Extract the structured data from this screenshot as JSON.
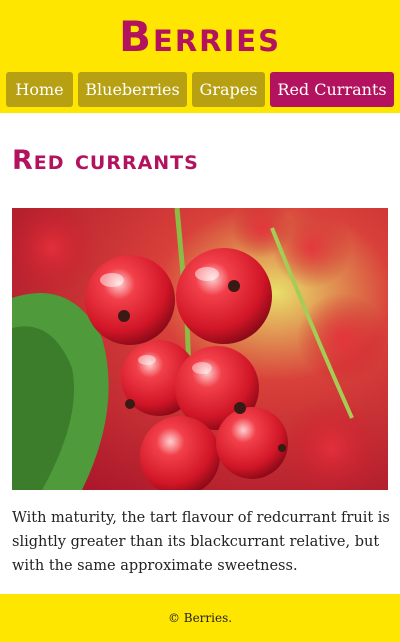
{
  "header": {
    "title": "Berries"
  },
  "nav": {
    "items": [
      {
        "label": "Home",
        "active": false
      },
      {
        "label": "Blueberries",
        "active": false
      },
      {
        "label": "Grapes",
        "active": false
      },
      {
        "label": "Red Currants",
        "active": true
      }
    ]
  },
  "main": {
    "heading": "Red currants",
    "image": {
      "subject": "red-currants-photo"
    },
    "paragraph": "With maturity, the tart flavour of redcurrant fruit is slightly greater than its blackcurrant relative, but with the same approximate sweetness."
  },
  "footer": {
    "text": "© Berries."
  },
  "colors": {
    "brand_yellow": "#ffe600",
    "brand_magenta": "#b3125e",
    "nav_olive": "#b8a013"
  }
}
